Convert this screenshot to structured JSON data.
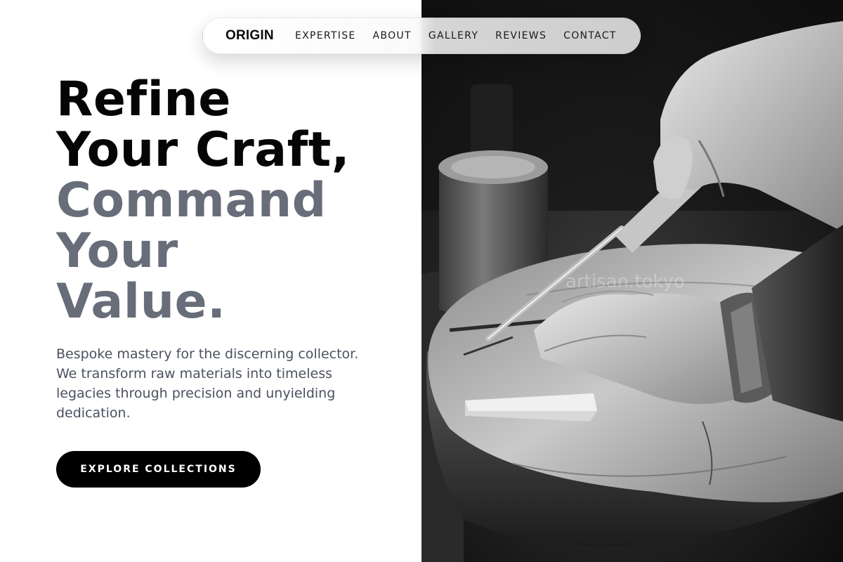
{
  "nav": {
    "logo": "ORIGIN",
    "links": [
      "EXPERTISE",
      "ABOUT",
      "GALLERY",
      "REVIEWS",
      "CONTACT"
    ]
  },
  "hero": {
    "headline_dark": [
      "Refine",
      "Your Craft,"
    ],
    "headline_gray": [
      "Command",
      "Your",
      "Value."
    ],
    "description": "Bespoke mastery for the discerning collector. We transform raw materials into timeless legacies through precision and unyielding dedication.",
    "cta_label": "EXPLORE COLLECTIONS"
  },
  "image": {
    "watermark": "artisan.tokyo"
  },
  "colors": {
    "headline_dark": "#050505",
    "headline_gray": "#676d79",
    "body_text": "#4b5160",
    "cta_background": "#000000",
    "cta_text": "#ffffff"
  }
}
